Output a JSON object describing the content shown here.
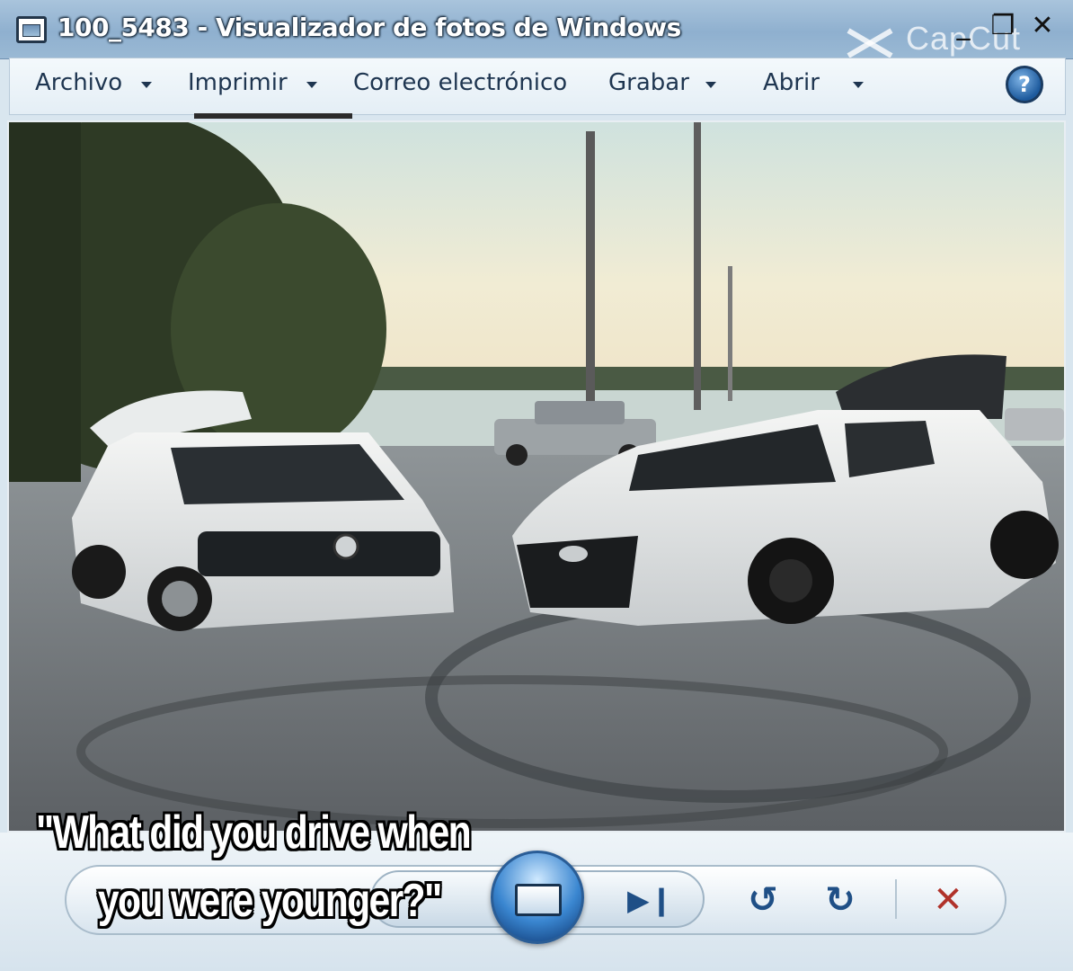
{
  "window": {
    "title": "100_5483 - Visualizador de fotos de Windows",
    "watermark": "CapCut",
    "controls": {
      "minimize": "_",
      "maximize": "❐",
      "close": "✕"
    }
  },
  "menu": {
    "items": [
      {
        "label": "Archivo",
        "has_dropdown": true
      },
      {
        "label": "Imprimir",
        "has_dropdown": true
      },
      {
        "label": "Correo electrónico",
        "has_dropdown": false
      },
      {
        "label": "Grabar",
        "has_dropdown": true
      },
      {
        "label": "Abrir",
        "has_dropdown": true
      }
    ],
    "help_glyph": "?"
  },
  "photo": {
    "description_icon": "photo-image"
  },
  "caption": {
    "line1": "\"What did you drive when",
    "line2": "you were younger?\""
  },
  "playback": {
    "next_glyph": "▶❙",
    "rotate_ccw_glyph": "↺",
    "rotate_cw_glyph": "↻",
    "delete_glyph": "✕"
  },
  "colors": {
    "delete_red": "#b0322a",
    "accent_blue": "#1f4f86"
  }
}
